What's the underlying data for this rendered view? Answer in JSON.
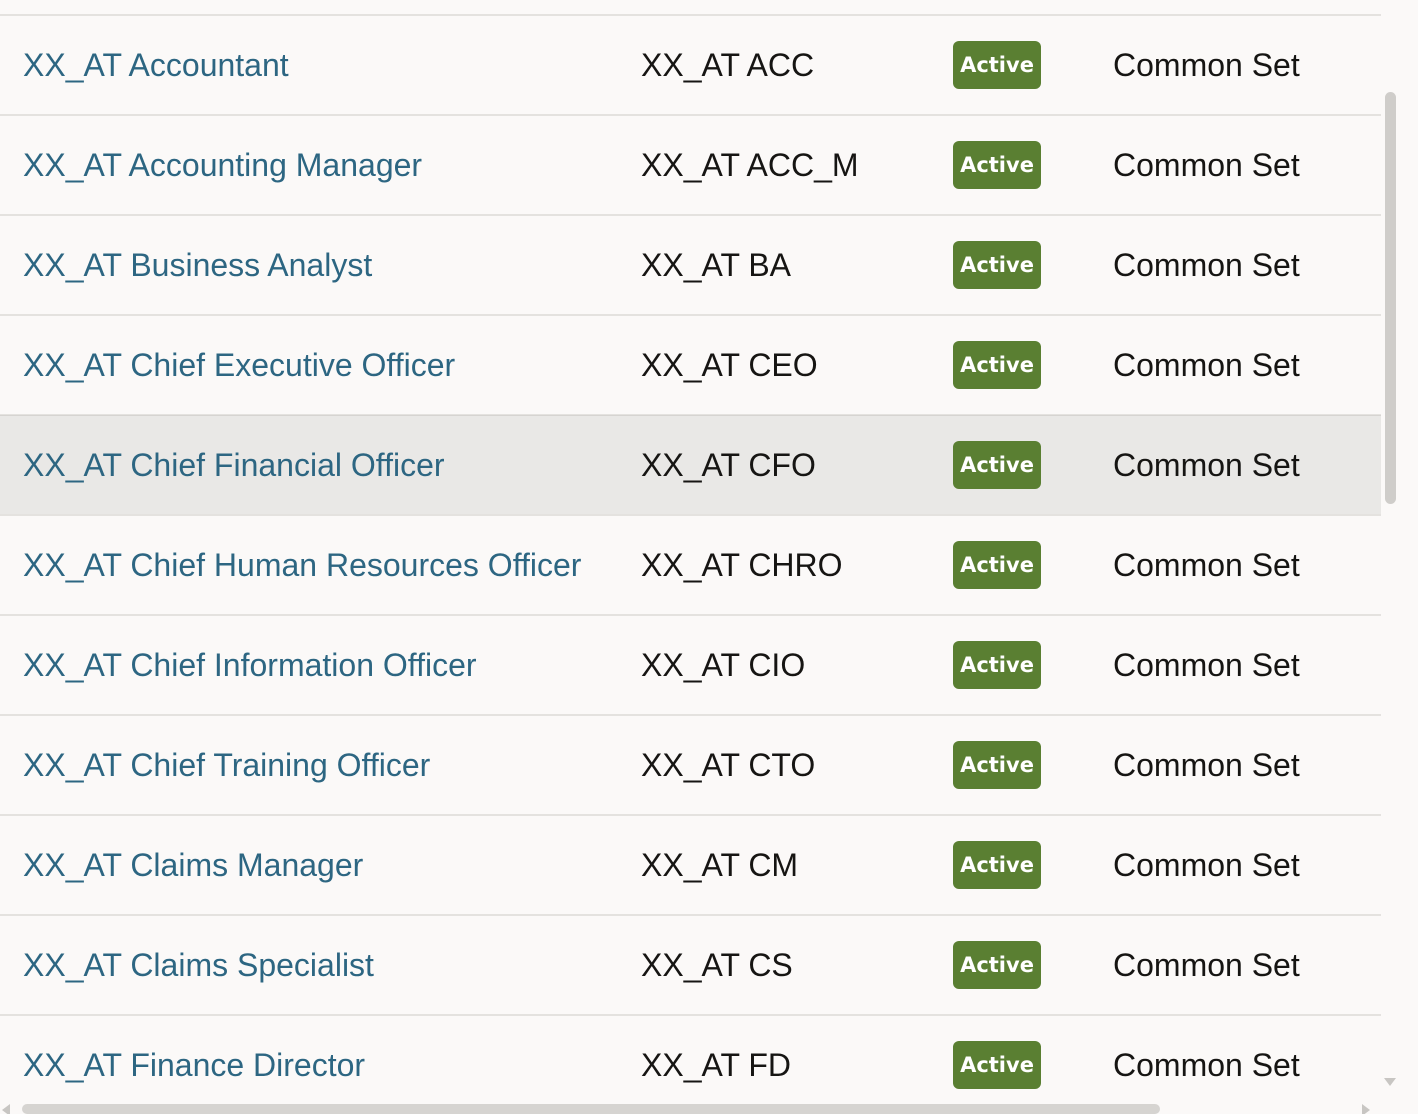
{
  "table": {
    "status_color": "#5a7f32",
    "link_color": "#2d6682",
    "rows": [
      {
        "name": "XX_AT Accountant",
        "code": "XX_AT ACC",
        "status": "Active",
        "set": "Common Set"
      },
      {
        "name": "XX_AT Accounting Manager",
        "code": "XX_AT ACC_M",
        "status": "Active",
        "set": "Common Set"
      },
      {
        "name": "XX_AT Business Analyst",
        "code": "XX_AT BA",
        "status": "Active",
        "set": "Common Set"
      },
      {
        "name": "XX_AT Chief Executive Officer",
        "code": "XX_AT CEO",
        "status": "Active",
        "set": "Common Set"
      },
      {
        "name": "XX_AT Chief Financial Officer",
        "code": "XX_AT CFO",
        "status": "Active",
        "set": "Common Set",
        "highlighted": true
      },
      {
        "name": "XX_AT Chief Human Resources Officer",
        "code": "XX_AT CHRO",
        "status": "Active",
        "set": "Common Set"
      },
      {
        "name": "XX_AT Chief Information Officer",
        "code": "XX_AT CIO",
        "status": "Active",
        "set": "Common Set"
      },
      {
        "name": "XX_AT Chief Training Officer",
        "code": "XX_AT CTO",
        "status": "Active",
        "set": "Common Set"
      },
      {
        "name": "XX_AT Claims Manager",
        "code": "XX_AT CM",
        "status": "Active",
        "set": "Common Set"
      },
      {
        "name": "XX_AT Claims Specialist",
        "code": "XX_AT CS",
        "status": "Active",
        "set": "Common Set"
      },
      {
        "name": "XX_AT Finance Director",
        "code": "XX_AT FD",
        "status": "Active",
        "set": "Common Set"
      }
    ]
  },
  "scrollbars": {
    "vertical_icon": "chevron-down-icon",
    "horizontal_icons": [
      "chevron-left-icon",
      "chevron-right-icon"
    ]
  }
}
